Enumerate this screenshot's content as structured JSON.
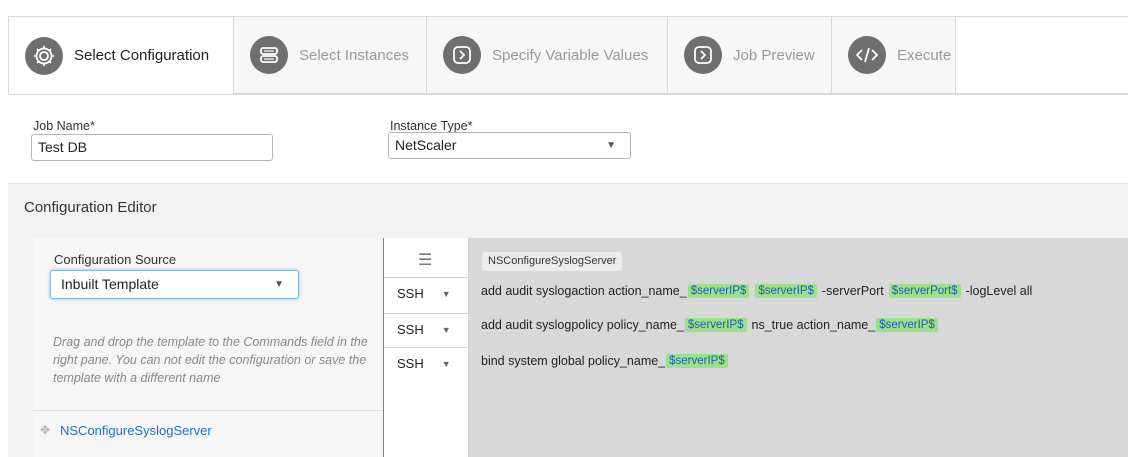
{
  "steps": [
    {
      "label": "Select Configuration",
      "icon": "gear-icon",
      "active": true
    },
    {
      "label": "Select Instances",
      "icon": "server-icon",
      "active": false
    },
    {
      "label": "Specify Variable Values",
      "icon": "chevron-right-icon",
      "active": false
    },
    {
      "label": "Job Preview",
      "icon": "chevron-right-icon",
      "active": false
    },
    {
      "label": "Execute",
      "icon": "code-icon",
      "active": false
    }
  ],
  "job": {
    "name_label": "Job Name*",
    "name_value": "Test DB",
    "instance_type_label": "Instance Type*",
    "instance_type_value": "NetScaler"
  },
  "editor": {
    "title": "Configuration Editor",
    "source_label": "Configuration Source",
    "source_value": "Inbuilt Template",
    "help_text": "Drag and drop the template to the Commands field in the right pane. You can not edit the configuration or save the template with a different name",
    "template_item": "NSConfigureSyslogServer",
    "command_group": "NSConfigureSyslogServer",
    "rows": [
      {
        "protocol": "SSH",
        "parts": [
          {
            "t": "add audit syslogaction action_name_"
          },
          {
            "v": "$serverIP$"
          },
          {
            "v": "$serverIP$"
          },
          {
            "t": "-serverPort"
          },
          {
            "v": "$serverPort$"
          },
          {
            "t": "-logLevel all"
          }
        ]
      },
      {
        "protocol": "SSH",
        "parts": [
          {
            "t": "add audit syslogpolicy policy_name_"
          },
          {
            "v": "$serverIP$"
          },
          {
            "t": "ns_true action_name_"
          },
          {
            "v": "$serverIP$"
          }
        ]
      },
      {
        "protocol": "SSH",
        "parts": [
          {
            "t": "bind system global policy_name_"
          },
          {
            "v": "$serverIP$"
          }
        ]
      }
    ]
  },
  "colors": {
    "accent": "#1a73c8",
    "variable_bg": "#9de08a",
    "icon_bg": "#6f6f6f"
  }
}
